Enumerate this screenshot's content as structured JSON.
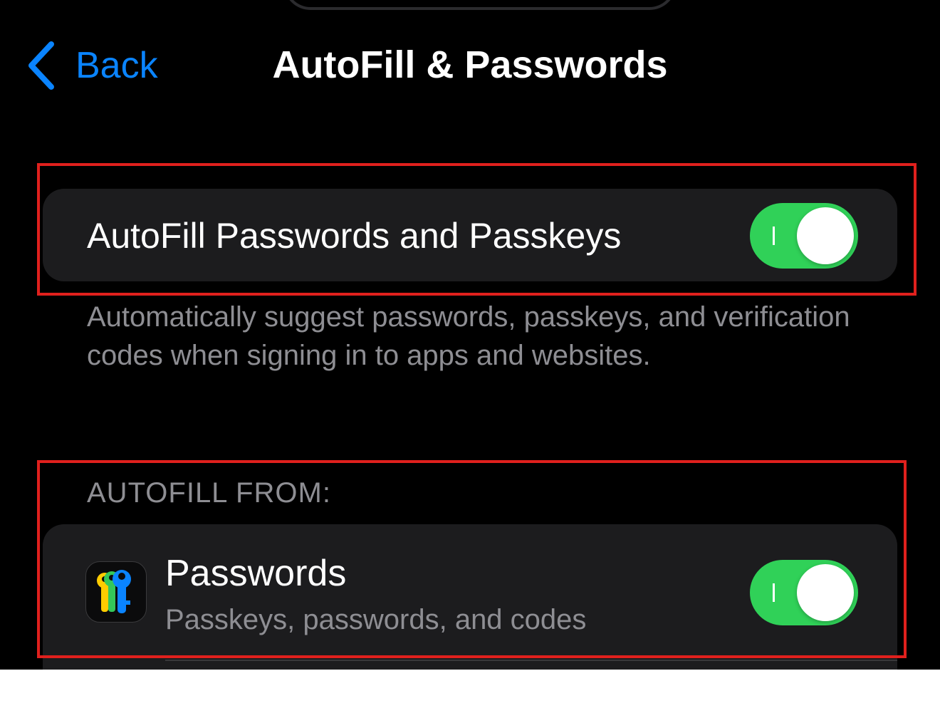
{
  "nav": {
    "back_label": "Back",
    "title": "AutoFill & Passwords"
  },
  "autofill_toggle": {
    "label": "AutoFill Passwords and Passkeys",
    "enabled": true,
    "footnote": "Automatically suggest passwords, passkeys, and verification codes when signing in to apps and websites."
  },
  "autofill_from": {
    "header": "AUTOFILL FROM:",
    "items": [
      {
        "title": "Passwords",
        "subtitle": "Passkeys, passwords, and codes",
        "icon": "passwords-app-icon",
        "enabled": true
      }
    ]
  },
  "colors": {
    "accent": "#0a84ff",
    "toggle_on": "#30d158",
    "highlight": "#e0201d",
    "background": "#000000",
    "card": "#1c1c1e",
    "secondary_text": "#8e8e93"
  }
}
